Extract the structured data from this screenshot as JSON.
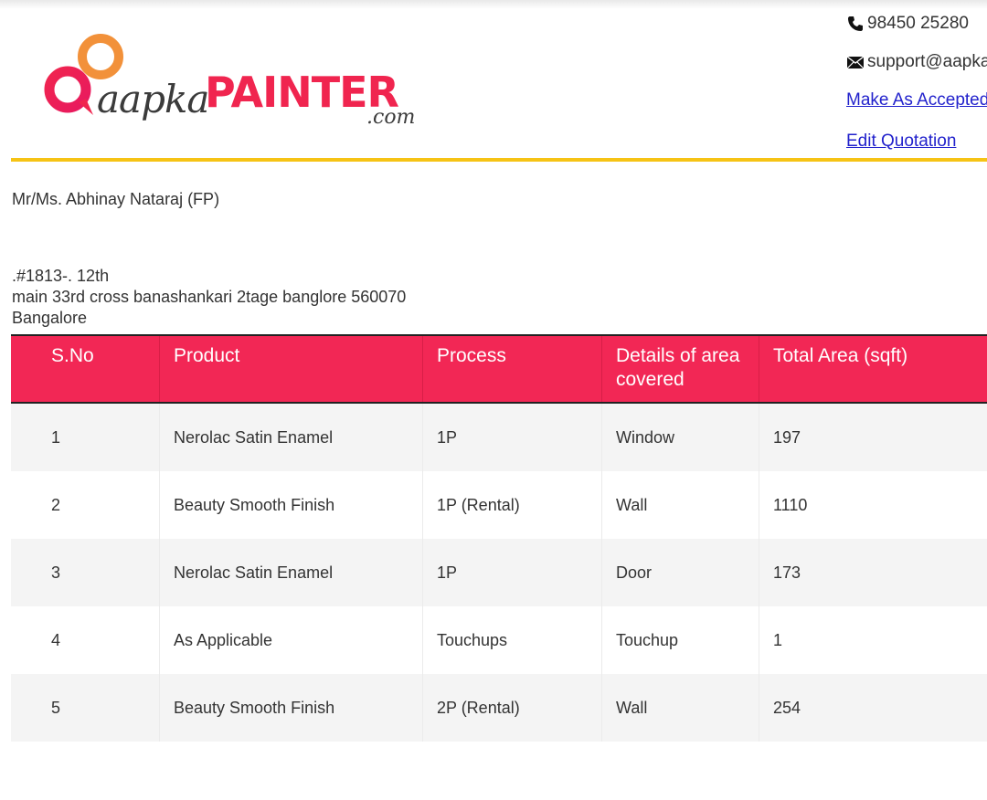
{
  "logo": {
    "part1": "aapka",
    "part2": "PAINTER",
    "part3": ".com",
    "colors": {
      "brand": "#f0254f",
      "accent": "#f2913a",
      "text": "#3b3b3b"
    }
  },
  "contact": {
    "phone": "98450 25280",
    "email": "support@aapka",
    "make_accepted_label": "Make As Accepted",
    "edit_quotation_label": "Edit Quotation",
    "phone_icon": "phone-icon",
    "email_icon": "envelope-icon"
  },
  "customer": {
    "name": "Mr/Ms. Abhinay Nataraj (FP)",
    "address_line1": ".#1813-. 12th",
    "address_line2": "main 33rd cross banashankari 2tage banglore 560070",
    "address_line3": "Bangalore"
  },
  "table": {
    "headers": [
      "S.No",
      "Product",
      "Process",
      "Details of area covered",
      "Total Area (sqft)"
    ],
    "rows": [
      [
        "1",
        "Nerolac Satin Enamel",
        "1P",
        "Window",
        "197"
      ],
      [
        "2",
        "Beauty Smooth Finish",
        "1P (Rental)",
        "Wall",
        "1110"
      ],
      [
        "3",
        "Nerolac Satin Enamel",
        "1P",
        "Door",
        "173"
      ],
      [
        "4",
        "As Applicable",
        "Touchups",
        "Touchup",
        "1"
      ],
      [
        "5",
        "Beauty Smooth Finish",
        "2P (Rental)",
        "Wall",
        "254"
      ]
    ],
    "header_color": "#f22755",
    "divider_color": "#f6c315"
  }
}
